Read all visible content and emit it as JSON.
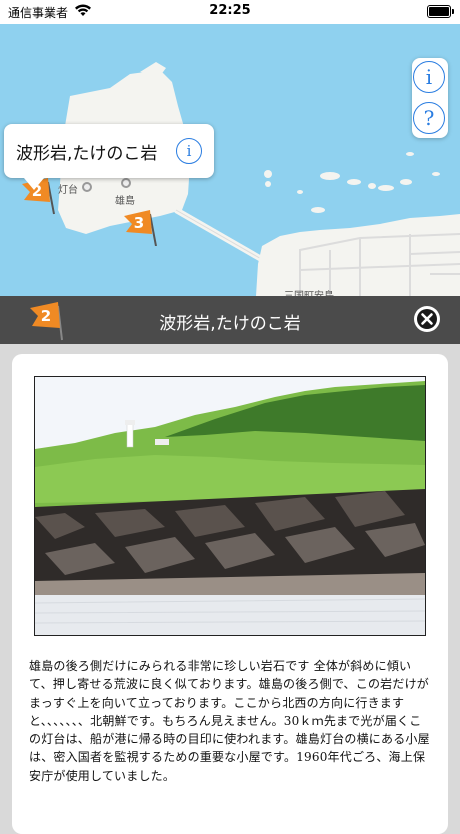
{
  "status_bar": {
    "carrier": "通信事業者",
    "time": "22:25"
  },
  "map": {
    "callout_title": "波形岩,たけのこ岩",
    "labels": {
      "lighthouse": "灯台",
      "island": "雄島",
      "town": "三国町安島"
    },
    "pins": [
      {
        "number": "2",
        "color": "#f08a24"
      },
      {
        "number": "3",
        "color": "#f08a24"
      }
    ],
    "buttons": {
      "info": "i",
      "help": "?"
    }
  },
  "detail": {
    "header_pin_number": "2",
    "title": "波形岩,たけのこ岩",
    "description": "雄島の後ろ側だけにみられる非常に珍しい岩石です 全体が斜めに傾いて、押し寄せる荒波に良く似ております。雄島の後ろ側で、この岩だけがまっすぐ上を向いて立っております。ここから北西の方向に行きますと、、、、、、、北朝鮮です。もちろん見えません。30ｋｍ先まで光が届くこの灯台は、船が港に帰る時の目印に使われます。雄島灯台の横にある小屋は、密入国者を監視するための重要な小屋です。1960年代ごろ、海上保安庁が使用していました。"
  },
  "colors": {
    "sea": "#8fd1ef",
    "land": "#f4f4f0",
    "pin": "#f08a24",
    "accent": "#2a7de1",
    "header_bg": "#4b4b4b"
  }
}
